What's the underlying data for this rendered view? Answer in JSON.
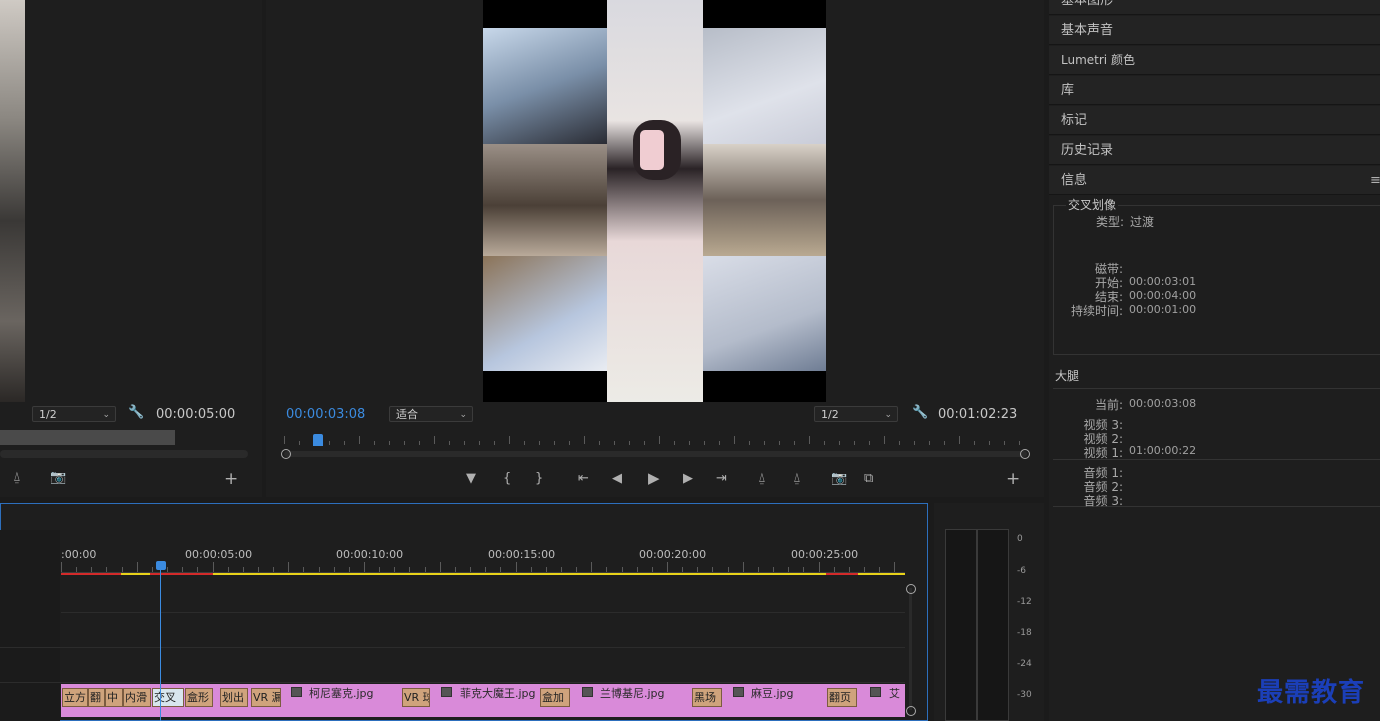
{
  "source_monitor": {
    "zoom": "1/2",
    "duration": "00:00:05:00"
  },
  "program_monitor": {
    "timecode": "00:00:03:08",
    "fit": "适合",
    "zoom": "1/2",
    "duration": "00:01:02:23"
  },
  "right_panel": {
    "menu_items": [
      "基本图形",
      "基本声音",
      "Lumetri 颜色",
      "库",
      "标记",
      "历史记录"
    ],
    "info_tab": "信息",
    "info": {
      "title": "交叉划像",
      "type_label": "类型:",
      "type_value": "过渡",
      "tape_label": "磁带:",
      "start_label": "开始:",
      "start_value": "00:00:03:01",
      "end_label": "结束:",
      "end_value": "00:00:04:00",
      "duration_label": "持续时间:",
      "duration_value": "00:00:01:00"
    },
    "sequence": {
      "name": "大腿",
      "current_label": "当前:",
      "current_value": "00:00:03:08",
      "video3_label": "视频 3:",
      "video2_label": "视频 2:",
      "video1_label": "视频 1:",
      "video1_value": "01:00:00:22",
      "audio1_label": "音频 1:",
      "audio2_label": "音频 2:",
      "audio3_label": "音频 3:"
    }
  },
  "timeline": {
    "ruler": [
      ":00:00",
      "00:00:05:00",
      "00:00:10:00",
      "00:00:15:00",
      "00:00:20:00",
      "00:00:25:00"
    ],
    "transitions": [
      "立方",
      "翻",
      "中",
      "内滑",
      "交叉",
      "盒形",
      "划出",
      "VR 漏",
      "VR 球",
      "盒加",
      "黑场",
      "翻页"
    ],
    "clips": [
      "柯尼塞克.jpg",
      "菲克大魔王.jpg",
      "兰博基尼.jpg",
      "麻豆.jpg",
      "艾"
    ]
  },
  "audio_meter": {
    "scale": [
      "0",
      "-6",
      "-12",
      "-18",
      "-24",
      "-30"
    ]
  },
  "watermark": "最需教育"
}
